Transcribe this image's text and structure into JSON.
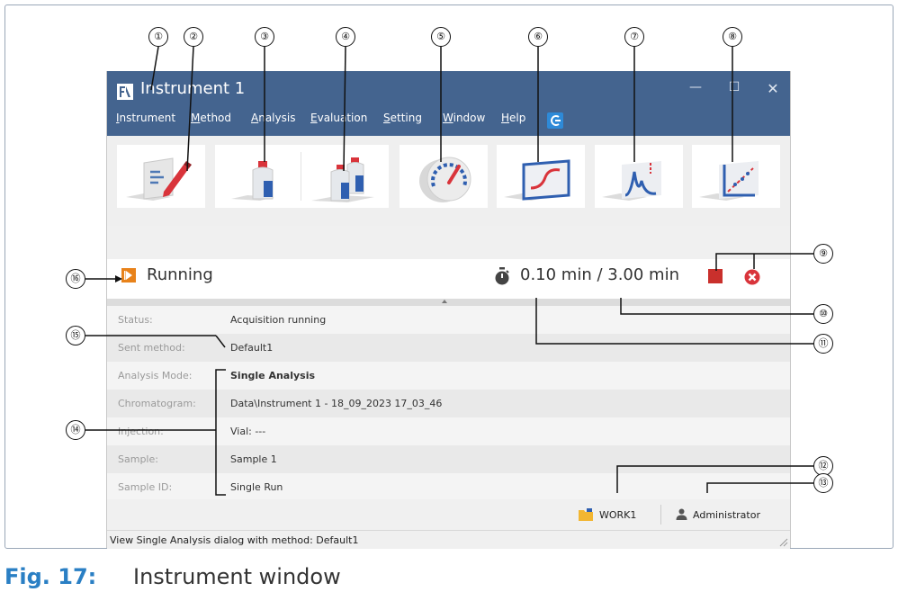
{
  "window": {
    "title": "Instrument 1",
    "controls": {
      "minimize": "—",
      "maximize": "☐",
      "close": "✕"
    }
  },
  "menu": {
    "items": [
      {
        "mnemonic": "I",
        "rest": "nstrument"
      },
      {
        "mnemonic": "M",
        "rest": "ethod"
      },
      {
        "mnemonic": "A",
        "rest": "nalysis"
      },
      {
        "mnemonic": "E",
        "rest": "valuation"
      },
      {
        "mnemonic": "S",
        "rest": "etting"
      },
      {
        "mnemonic": "W",
        "rest": "indow"
      },
      {
        "mnemonic": "H",
        "rest": "elp"
      }
    ]
  },
  "toolbar": {
    "buttons": [
      {
        "icon": "method-editor-icon"
      },
      {
        "icon": "single-analysis-icon"
      },
      {
        "icon": "sequence-icon"
      },
      {
        "icon": "monitoring-icon"
      },
      {
        "icon": "data-acquisition-icon"
      },
      {
        "icon": "chromatogram-evaluation-icon"
      },
      {
        "icon": "calibration-icon"
      }
    ]
  },
  "run": {
    "status": "Running",
    "time": "0.10 min / 3.00 min"
  },
  "details": {
    "rows": [
      {
        "label": "Status:",
        "value": "Acquisition running",
        "bold": false
      },
      {
        "label": "Sent method:",
        "value": "Default1",
        "bold": false
      },
      {
        "label": "Analysis Mode:",
        "value": "Single Analysis",
        "bold": true
      },
      {
        "label": "Chromatogram:",
        "value": "Data\\Instrument 1 - 18_09_2023 17_03_46",
        "bold": false
      },
      {
        "label": "Injection:",
        "value": "Vial: ---",
        "bold": false
      },
      {
        "label": "Sample:",
        "value": "Sample 1",
        "bold": false
      },
      {
        "label": "Sample ID:",
        "value": "Single Run",
        "bold": false
      }
    ]
  },
  "statusbar": {
    "workspace": "WORK1",
    "user": "Administrator",
    "hint": "View Single Analysis dialog with method: Default1"
  },
  "callouts": [
    "①",
    "②",
    "③",
    "④",
    "⑤",
    "⑥",
    "⑦",
    "⑧",
    "⑨",
    "⑩",
    "⑪",
    "⑫",
    "⑬",
    "⑭",
    "⑮",
    "⑯"
  ],
  "caption": {
    "number": "Fig. 17:",
    "text": "Instrument window"
  },
  "colors": {
    "titlebar": "#44648f",
    "accent_blue": "#2a7fc4",
    "stop_red": "#c9302c",
    "run_orange": "#e8821a"
  }
}
